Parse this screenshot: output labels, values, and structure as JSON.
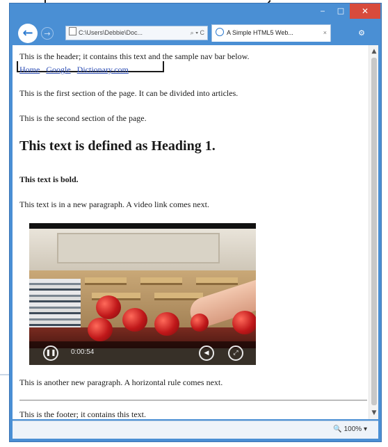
{
  "window": {
    "title_controls": {
      "minimize": "‒",
      "maximize": "□",
      "close": "✕"
    }
  },
  "toolbar": {
    "back_icon": "back-arrow-icon",
    "back_glyph": "←",
    "forward_glyph": "→",
    "address_text": "C:\\Users\\Debbie\\Doc...",
    "address_tail": "⌕ ▾ C",
    "tab_title": "A Simple HTML5 Web...",
    "tab_close": "×",
    "tools_glyph": "⚙"
  },
  "page": {
    "header_text": "This is the header; it contains this text and the sample nav bar below.",
    "nav_links": [
      "Home",
      "Google",
      "Dictionary.com"
    ],
    "section1": "This is the first section of the page. It can be divided into articles.",
    "section2": "This is the second section of the page.",
    "heading1": "This text is defined as Heading 1.",
    "bold_text": "This text is bold.",
    "paragraph_video": "This text is in a new paragraph. A video link comes next.",
    "video": {
      "time": "0:00:54",
      "play_glyph": "❚❚",
      "volume_glyph": "◀",
      "fullscreen_glyph": "⤢"
    },
    "paragraph_hr": "This is another new paragraph. A horizontal rule comes next.",
    "footer_text": "This is the footer; it contains this text."
  },
  "status": {
    "zoom": "🔍 100%  ▾"
  },
  "scrollbar": {
    "up": "▲",
    "down": "▼"
  },
  "colors": {
    "chrome_blue": "#4a8fd4",
    "close_red": "#d84b3c",
    "link": "#2f4fb5"
  }
}
